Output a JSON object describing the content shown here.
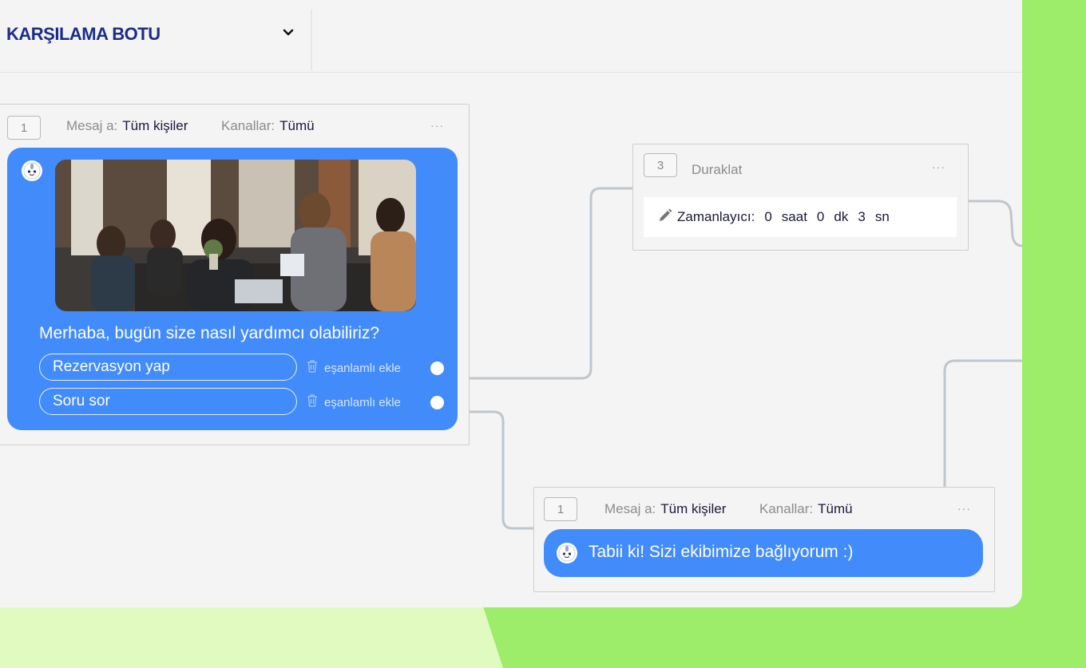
{
  "header": {
    "bot_title": "KARŞILAMA BOTU"
  },
  "node1": {
    "number": "1",
    "message_to_label": "Mesaj a:",
    "message_to_value": "Tüm kişiler",
    "channels_label": "Kanallar:",
    "channels_value": "Tümü",
    "menu": "···",
    "message": "Merhaba, bugün size nasıl yardımcı olabiliriz?",
    "quick_replies": [
      {
        "label": "Rezervasyon yap",
        "synonym_action": "eşanlamlı ekle"
      },
      {
        "label": "Soru sor",
        "synonym_action": "eşanlamlı ekle"
      }
    ]
  },
  "node3": {
    "number": "3",
    "title": "Duraklat",
    "menu": "···",
    "timer_label": "Zamanlayıcı:",
    "hours": "0",
    "hours_unit": "saat",
    "minutes": "0",
    "minutes_unit": "dk",
    "seconds": "3",
    "seconds_unit": "sn"
  },
  "node_bottom": {
    "number": "1",
    "message_to_label": "Mesaj a:",
    "message_to_value": "Tüm kişiler",
    "channels_label": "Kanallar:",
    "channels_value": "Tümü",
    "menu": "···",
    "message": "Tabii ki! Sizi ekibimize bağlıyorum :)"
  },
  "colors": {
    "bubble": "#428bfa",
    "title": "#1c2c8a",
    "accent_green": "#9ded6a",
    "light_green": "#e0fac0"
  },
  "icons": {
    "chevron": "chevron-down-icon",
    "avatar": "bot-avatar-icon",
    "trash": "trash-icon",
    "pencil": "pencil-icon"
  }
}
